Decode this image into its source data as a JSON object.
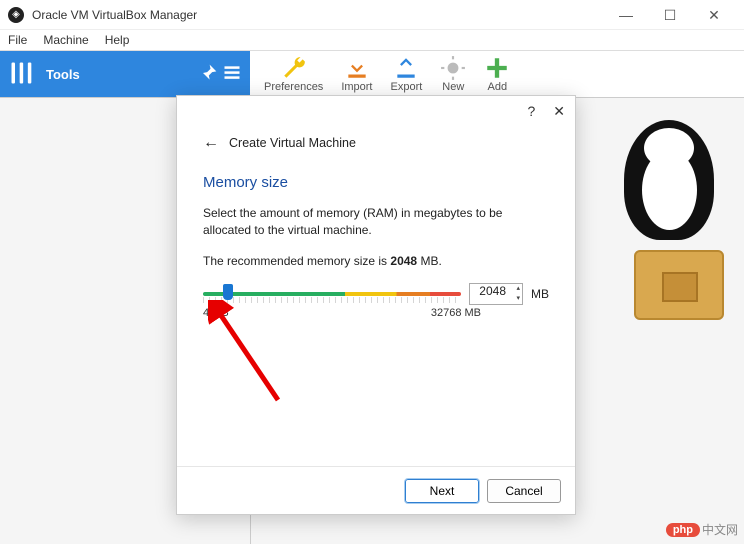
{
  "window": {
    "title": "Oracle VM VirtualBox Manager"
  },
  "menu": {
    "file": "File",
    "machine": "Machine",
    "help": "Help"
  },
  "sidebar": {
    "tools_label": "Tools"
  },
  "toolbar": {
    "preferences": "Preferences",
    "import": "Import",
    "export": "Export",
    "new": "New",
    "add": "Add"
  },
  "dialog": {
    "back_label": "Create Virtual Machine",
    "section_title": "Memory size",
    "desc": "Select the amount of memory (RAM) in megabytes to be allocated to the virtual machine.",
    "rec_prefix": "The recommended memory size is ",
    "rec_value": "2048",
    "rec_suffix": " MB.",
    "slider_min": "4 MB",
    "slider_max": "32768 MB",
    "value": "2048",
    "unit": "MB",
    "next": "Next",
    "cancel": "Cancel"
  },
  "watermark": {
    "brand": "php",
    "text": "中文网"
  }
}
